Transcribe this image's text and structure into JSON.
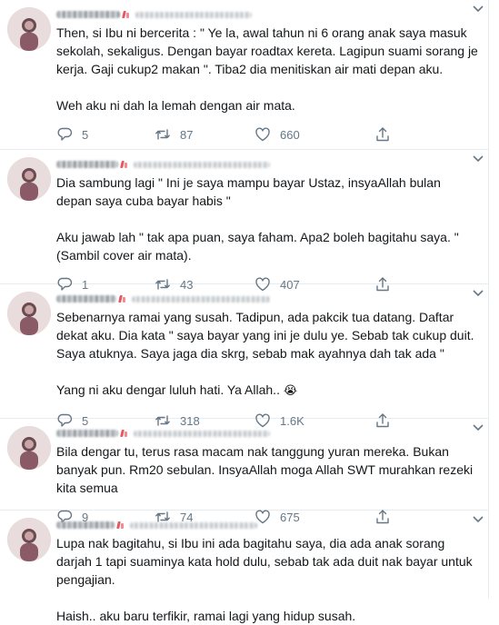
{
  "tweets": [
    {
      "paragraphs": [
        "Then, si Ibu ni bercerita : \" Ye la, awal tahun ni 6 orang anak saya masuk sekolah, sekaligus. Dengan bayar roadtax kereta. Lagipun suami sorang je kerja. Gaji cukup2 makan \". Tiba2 dia menitiskan air mati depan aku.",
        "Weh aku ni dah la lemah dengan air mata."
      ],
      "replies": "5",
      "retweets": "87",
      "likes": "660"
    },
    {
      "paragraphs": [
        "Dia sambung lagi \" Ini je saya mampu bayar Ustaz, insyaAllah bulan depan saya cuba bayar habis \"",
        "Aku jawab lah \" tak apa puan, saya faham. Apa2 boleh bagitahu saya. \" (Sambil cover air mata)."
      ],
      "replies": "1",
      "retweets": "43",
      "likes": "407"
    },
    {
      "paragraphs": [
        "Sebenarnya ramai yang susah. Tadipun, ada pakcik tua datang. Daftar dekat aku. Dia kata \" saya bayar yang ini je dulu ye. Sebab tak cukup duit. Saya atuknya. Saya jaga dia skrg, sebab mak ayahnya dah tak ada \"",
        "Yang ni aku dengar luluh hati. Ya Allah.."
      ],
      "emoji": "😭",
      "replies": "5",
      "retweets": "318",
      "likes": "1.6K"
    },
    {
      "paragraphs": [
        "Bila dengar tu, terus rasa macam nak tanggung yuran mereka. Bukan banyak pun. Rm20 sebulan. InsyaAllah moga Allah SWT murahkan rezeki kita semua"
      ],
      "replies": "9",
      "retweets": "74",
      "likes": "675"
    },
    {
      "paragraphs": [
        "Lupa nak bagitahu, si Ibu ini ada bagitahu saya, dia ada anak sorang darjah 1 tapi suaminya kata hold dulu, sebab tak ada duit nak bayar untuk pengajian.",
        "Haish.. aku baru terfikir, ramai lagi yang hidup susah."
      ]
    }
  ],
  "icons": {
    "reply": "reply-icon",
    "retweet": "retweet-icon",
    "like": "heart-icon",
    "share": "share-icon",
    "menu": "chevron-down-icon"
  },
  "colors": {
    "text": "#14171a",
    "muted": "#657786",
    "divider": "#e6ecf0"
  }
}
